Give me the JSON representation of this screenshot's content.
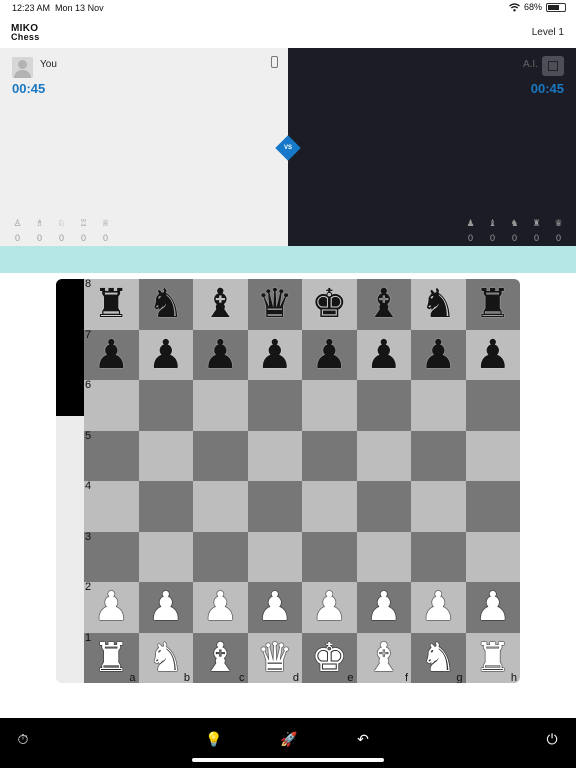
{
  "status": {
    "time": "12:23 AM",
    "date": "Mon 13 Nov",
    "battery": "68%",
    "battery_level": 0.68
  },
  "header": {
    "logo_line1": "MIKO",
    "logo_line2": "Chess",
    "level": "Level 1"
  },
  "player_left": {
    "name": "You",
    "timer": "00:45",
    "device_icon": "phone-icon",
    "captured": [
      {
        "piece": "♙",
        "count": "0"
      },
      {
        "piece": "♗",
        "count": "0"
      },
      {
        "piece": "♘",
        "count": "0"
      },
      {
        "piece": "♖",
        "count": "0"
      },
      {
        "piece": "♕",
        "count": "0"
      }
    ]
  },
  "player_right": {
    "name": "A.I.",
    "timer": "00:45",
    "device_icon": "chip-icon",
    "captured": [
      {
        "piece": "♟",
        "count": "0"
      },
      {
        "piece": "♝",
        "count": "0"
      },
      {
        "piece": "♞",
        "count": "0"
      },
      {
        "piece": "♜",
        "count": "0"
      },
      {
        "piece": "♛",
        "count": "0"
      }
    ]
  },
  "vs_label": "VS",
  "evaluation": {
    "black_fraction": 0.34
  },
  "board": {
    "files": [
      "a",
      "b",
      "c",
      "d",
      "e",
      "f",
      "g",
      "h"
    ],
    "ranks": [
      "8",
      "7",
      "6",
      "5",
      "4",
      "3",
      "2",
      "1"
    ],
    "rows": [
      [
        "bR",
        "bN",
        "bB",
        "bQ",
        "bK",
        "bB",
        "bN",
        "bR"
      ],
      [
        "bP",
        "bP",
        "bP",
        "bP",
        "bP",
        "bP",
        "bP",
        "bP"
      ],
      [
        "",
        "",
        "",
        "",
        "",
        "",
        "",
        ""
      ],
      [
        "",
        "",
        "",
        "",
        "",
        "",
        "",
        ""
      ],
      [
        "",
        "",
        "",
        "",
        "",
        "",
        "",
        ""
      ],
      [
        "",
        "",
        "",
        "",
        "",
        "",
        "",
        ""
      ],
      [
        "wP",
        "wP",
        "wP",
        "wP",
        "wP",
        "wP",
        "wP",
        "wP"
      ],
      [
        "wR",
        "wN",
        "wB",
        "wQ",
        "wK",
        "wB",
        "wN",
        "wR"
      ]
    ]
  },
  "toolbar": [
    {
      "name": "timer-icon",
      "glyph": "⏱"
    },
    {
      "name": "hint-bulb-icon",
      "glyph": "💡"
    },
    {
      "name": "rocket-icon",
      "glyph": "🚀"
    },
    {
      "name": "undo-icon",
      "glyph": "↶"
    },
    {
      "name": "power-icon",
      "glyph": "⏻"
    }
  ]
}
